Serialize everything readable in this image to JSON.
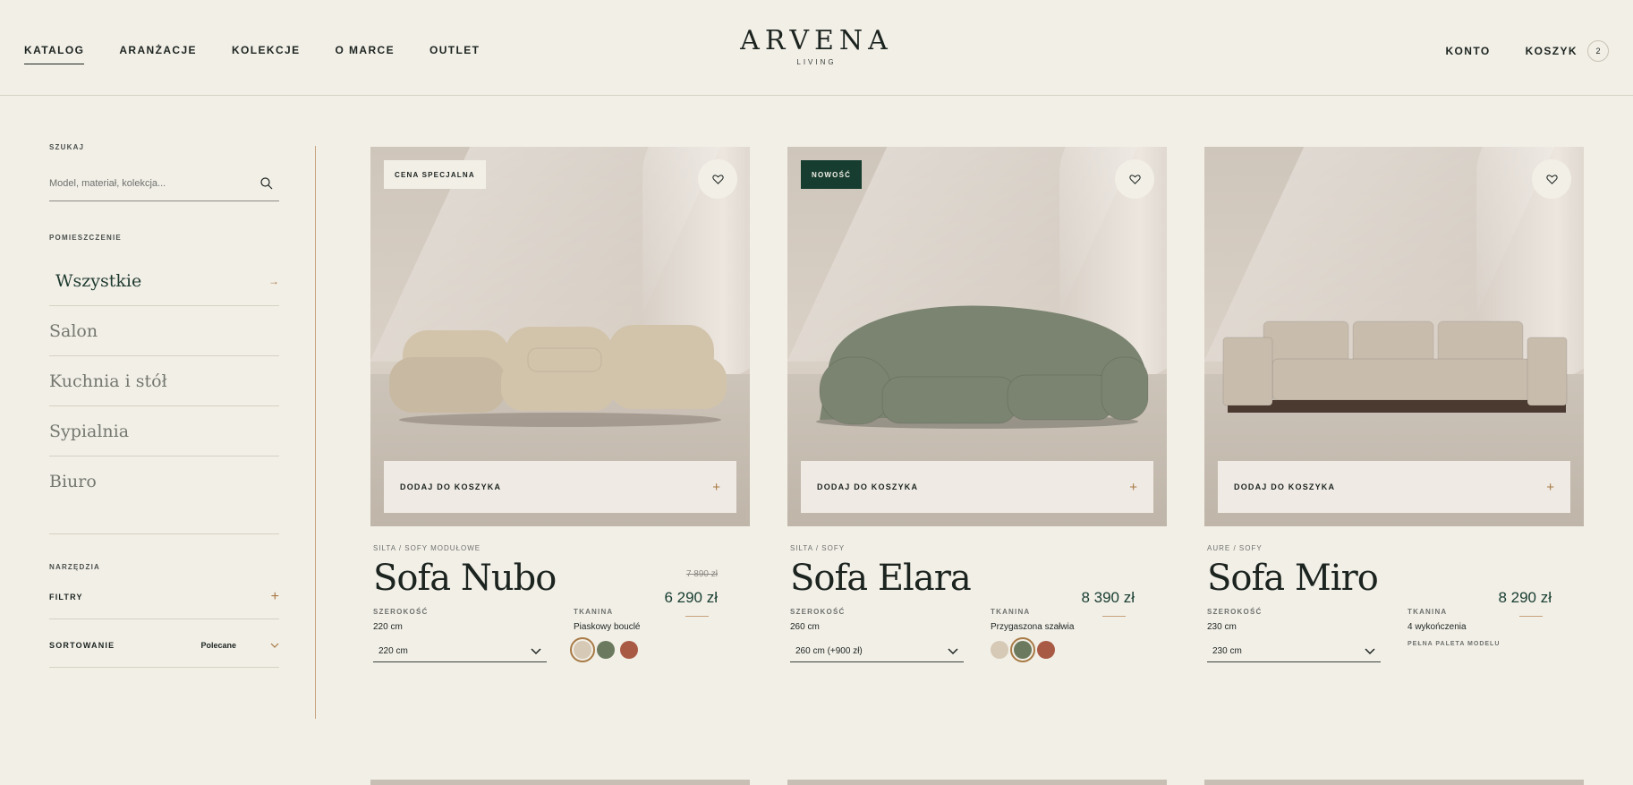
{
  "header": {
    "nav": [
      {
        "label": "KATALOG",
        "active": true
      },
      {
        "label": "ARANŻACJE",
        "active": false
      },
      {
        "label": "KOLEKCJE",
        "active": false
      },
      {
        "label": "O MARCE",
        "active": false
      },
      {
        "label": "OUTLET",
        "active": false
      }
    ],
    "brand": "ARVENA",
    "brand_sub": "LIVING",
    "account": "KONTO",
    "cart": "KOSZYK",
    "cart_count": "2"
  },
  "sidebar": {
    "search_label": "SZUKAJ",
    "search_placeholder": "Model, materiał, kolekcja...",
    "rooms_label": "POMIESZCZENIE",
    "rooms": [
      {
        "label": "Wszystkie",
        "active": true,
        "arrow": "→"
      },
      {
        "label": "Salon",
        "active": false,
        "arrow": ""
      },
      {
        "label": "Kuchnia i stół",
        "active": false,
        "arrow": ""
      },
      {
        "label": "Sypialnia",
        "active": false,
        "arrow": ""
      },
      {
        "label": "Biuro",
        "active": false,
        "arrow": ""
      }
    ],
    "tools_label": "NARZĘDZIA",
    "filters": "FILTRY",
    "filters_icon": "+",
    "sort": "SORTOWANIE",
    "sort_value": "Polecane"
  },
  "products": [
    {
      "badge": "CENA SPECJALNA",
      "badge_style": "light",
      "add_label": "DODAJ DO KOSZYKA",
      "add_icon": "+",
      "crumb": "SILTA / SOFY MODUŁOWE",
      "name": "Sofa Nubo",
      "old_price": "7 890 zł",
      "price": "6 290 zł",
      "width_label": "SZEROKOŚĆ",
      "width_value": "220 cm",
      "width_select": "220 cm",
      "fabric_label": "TKANINA",
      "fabric_value": "Piaskowy bouclé",
      "swatches": [
        "#d6c9b6",
        "#6b7a5e",
        "#a85a44"
      ],
      "selected_swatch": 0,
      "sofa_color": "#d2c4ab"
    },
    {
      "badge": "NOWOŚĆ",
      "badge_style": "dark",
      "add_label": "DODAJ DO KOSZYKA",
      "add_icon": "+",
      "crumb": "SILTA / SOFY",
      "name": "Sofa Elara",
      "old_price": "",
      "price": "8 390 zł",
      "width_label": "SZEROKOŚĆ",
      "width_value": "260 cm",
      "width_select": "260 cm (+900 zł)",
      "fabric_label": "TKANINA",
      "fabric_value": "Przygaszona szałwia",
      "swatches": [
        "#d6c9b6",
        "#6b7a5e",
        "#a85a44"
      ],
      "selected_swatch": 1,
      "sofa_color": "#7b8470"
    },
    {
      "badge": "",
      "badge_style": "",
      "add_label": "DODAJ DO KOSZYKA",
      "add_icon": "+",
      "crumb": "AURE / SOFY",
      "name": "Sofa Miro",
      "old_price": "",
      "price": "8 290 zł",
      "width_label": "SZEROKOŚĆ",
      "width_value": "230 cm",
      "width_select": "230 cm",
      "fabric_label": "TKANINA",
      "fabric_value": "4 wykończenia",
      "palette_link": "PEŁNA PALETA MODELU",
      "swatches": [],
      "selected_swatch": -1,
      "sofa_color": "#c8bcad"
    }
  ]
}
